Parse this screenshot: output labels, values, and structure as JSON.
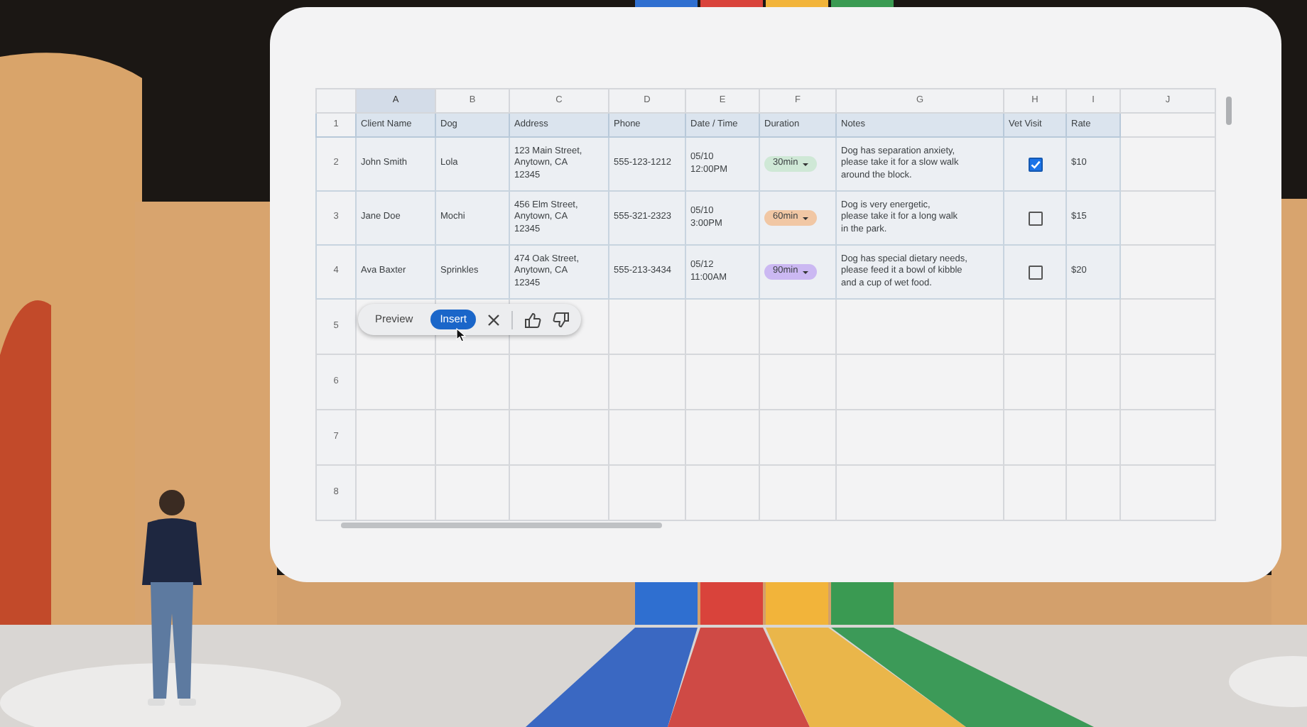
{
  "spreadsheet": {
    "column_letters": [
      {
        "label": "A",
        "selected": true
      },
      {
        "label": "B",
        "selected": false
      },
      {
        "label": "C",
        "selected": false
      },
      {
        "label": "D",
        "selected": false
      },
      {
        "label": "E",
        "selected": false
      },
      {
        "label": "F",
        "selected": false
      },
      {
        "label": "G",
        "selected": false
      },
      {
        "label": "H",
        "selected": false
      },
      {
        "label": "I",
        "selected": false
      },
      {
        "label": "J",
        "selected": false
      }
    ],
    "header_row": {
      "row_number": "1",
      "cells": [
        "Client Name",
        "Dog",
        "Address",
        "Phone",
        "Date / Time",
        "Duration",
        "Notes",
        "Vet Visit",
        "Rate"
      ]
    },
    "rows": [
      {
        "row_number": "2",
        "client_name": "John Smith",
        "dog": "Lola",
        "address": "123 Main Street,\nAnytown, CA\n12345",
        "phone": "555-123-1212",
        "date_time": "05/10\n12:00PM",
        "duration": {
          "label": "30min",
          "color": "#cfe8d6"
        },
        "notes": "Dog has separation anxiety,\nplease take it for a slow walk\naround the block.",
        "vet_visit": {
          "checked": true
        },
        "rate": "$10"
      },
      {
        "row_number": "3",
        "client_name": "Jane Doe",
        "dog": "Mochi",
        "address": "456 Elm Street,\nAnytown, CA\n12345",
        "phone": "555-321-2323",
        "date_time": "05/10\n3:00PM",
        "duration": {
          "label": "60min",
          "color": "#f1c7a4"
        },
        "notes": "Dog is very energetic,\nplease take it for a long walk\nin the park.",
        "vet_visit": {
          "checked": false
        },
        "rate": "$15"
      },
      {
        "row_number": "4",
        "client_name": "Ava Baxter",
        "dog": "Sprinkles",
        "address": "474 Oak Street,\nAnytown, CA\n12345",
        "phone": "555-213-3434",
        "date_time": "05/12\n11:00AM",
        "duration": {
          "label": "90min",
          "color": "#cbb8f2"
        },
        "notes": "Dog has special dietary needs,\nplease feed it a bowl of kibble\nand a cup of wet food.",
        "vet_visit": {
          "checked": false
        },
        "rate": "$20"
      }
    ],
    "empty_row_numbers": [
      "5",
      "6",
      "7",
      "8"
    ]
  },
  "suggestion_bar": {
    "preview": "Preview",
    "insert": "Insert"
  }
}
